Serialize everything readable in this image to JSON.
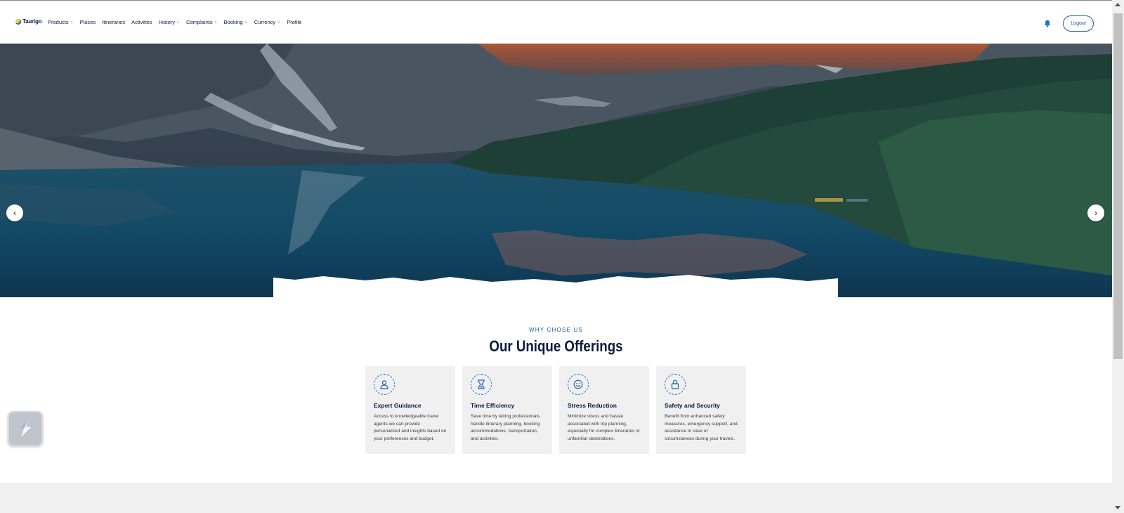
{
  "brand": {
    "logo_text": "Taurigo"
  },
  "nav": {
    "items": [
      {
        "label": "Products",
        "has_dropdown": true
      },
      {
        "label": "Places",
        "has_dropdown": false
      },
      {
        "label": "Itineraries",
        "has_dropdown": false
      },
      {
        "label": "Activities",
        "has_dropdown": false
      },
      {
        "label": "History",
        "has_dropdown": true
      },
      {
        "label": "Complaints",
        "has_dropdown": true
      },
      {
        "label": "Booking",
        "has_dropdown": true
      },
      {
        "label": "Currency",
        "has_dropdown": true
      },
      {
        "label": "Profile",
        "has_dropdown": false
      }
    ],
    "chevron_glyph": "⌄",
    "notification_icon": "bell-icon",
    "logout_label": "Logout"
  },
  "hero": {
    "prev_glyph": "‹",
    "next_glyph": "›"
  },
  "offerings": {
    "kicker": "WHY CHOSE US",
    "title": "Our Unique Offerings",
    "cards": [
      {
        "icon": "person-icon",
        "title": "Expert Guidance",
        "text": "Access to knowledgeable travel agents we can provide personalized and insights based on your preferences and budget."
      },
      {
        "icon": "hourglass-icon",
        "title": "Time Efficiency",
        "text": "Save time by letting professionals handle itinerary planning, booking accommodations, transportation, and activities."
      },
      {
        "icon": "smiley-icon",
        "title": "Stress Reduction",
        "text": "Minimize stress and hassle associated with trip planning, especially for complex itineraries or unfamiliar destinations."
      },
      {
        "icon": "lock-icon",
        "title": "Safety and Security",
        "text": "Benefit from enhanced safety measures, emergency support, and assistance in case of circumstances during your travels."
      }
    ]
  },
  "colors": {
    "accent": "#1f5fa8",
    "heading": "#0c1b3a",
    "card_bg": "#f0f0f0"
  }
}
